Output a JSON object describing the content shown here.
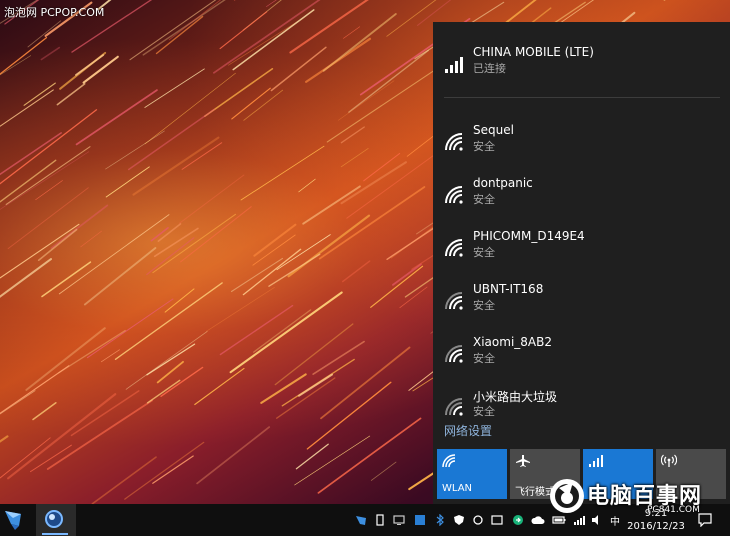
{
  "watermark_top": "泡泡网 PCPOP.COM",
  "network_flyout": {
    "cellular": {
      "name": "CHINA MOBILE (LTE)",
      "status": "已连接"
    },
    "wifi_networks": [
      {
        "name": "Sequel",
        "status": "安全"
      },
      {
        "name": "dontpanic",
        "status": "安全"
      },
      {
        "name": "PHICOMM_D149E4",
        "status": "安全"
      },
      {
        "name": "UBNT-IT168",
        "status": "安全"
      },
      {
        "name": "Xiaomi_8AB2",
        "status": "安全"
      },
      {
        "name": "小米路由大垃圾",
        "status": "安全"
      }
    ],
    "settings_link": "网络设置",
    "quick_actions": [
      {
        "label": "WLAN",
        "icon": "wifi-icon",
        "active": true
      },
      {
        "label": "飞行模式",
        "icon": "airplane-icon",
        "active": false
      },
      {
        "label": "",
        "icon": "cellular-icon",
        "active": true
      },
      {
        "label": "",
        "icon": "hotspot-icon",
        "active": false
      }
    ]
  },
  "taskbar": {
    "clock_time": "9:21",
    "clock_date": "2016/12/23"
  },
  "corner_logo": {
    "text": "电脑百事网",
    "url": "PC841.COM"
  },
  "colors": {
    "flyout_bg": "#1f1f1f",
    "accent": "#1a78d4",
    "tile_inactive": "#4a4a4a",
    "link": "#8fb4dc",
    "taskbar_bg": "#0f0f0f"
  }
}
